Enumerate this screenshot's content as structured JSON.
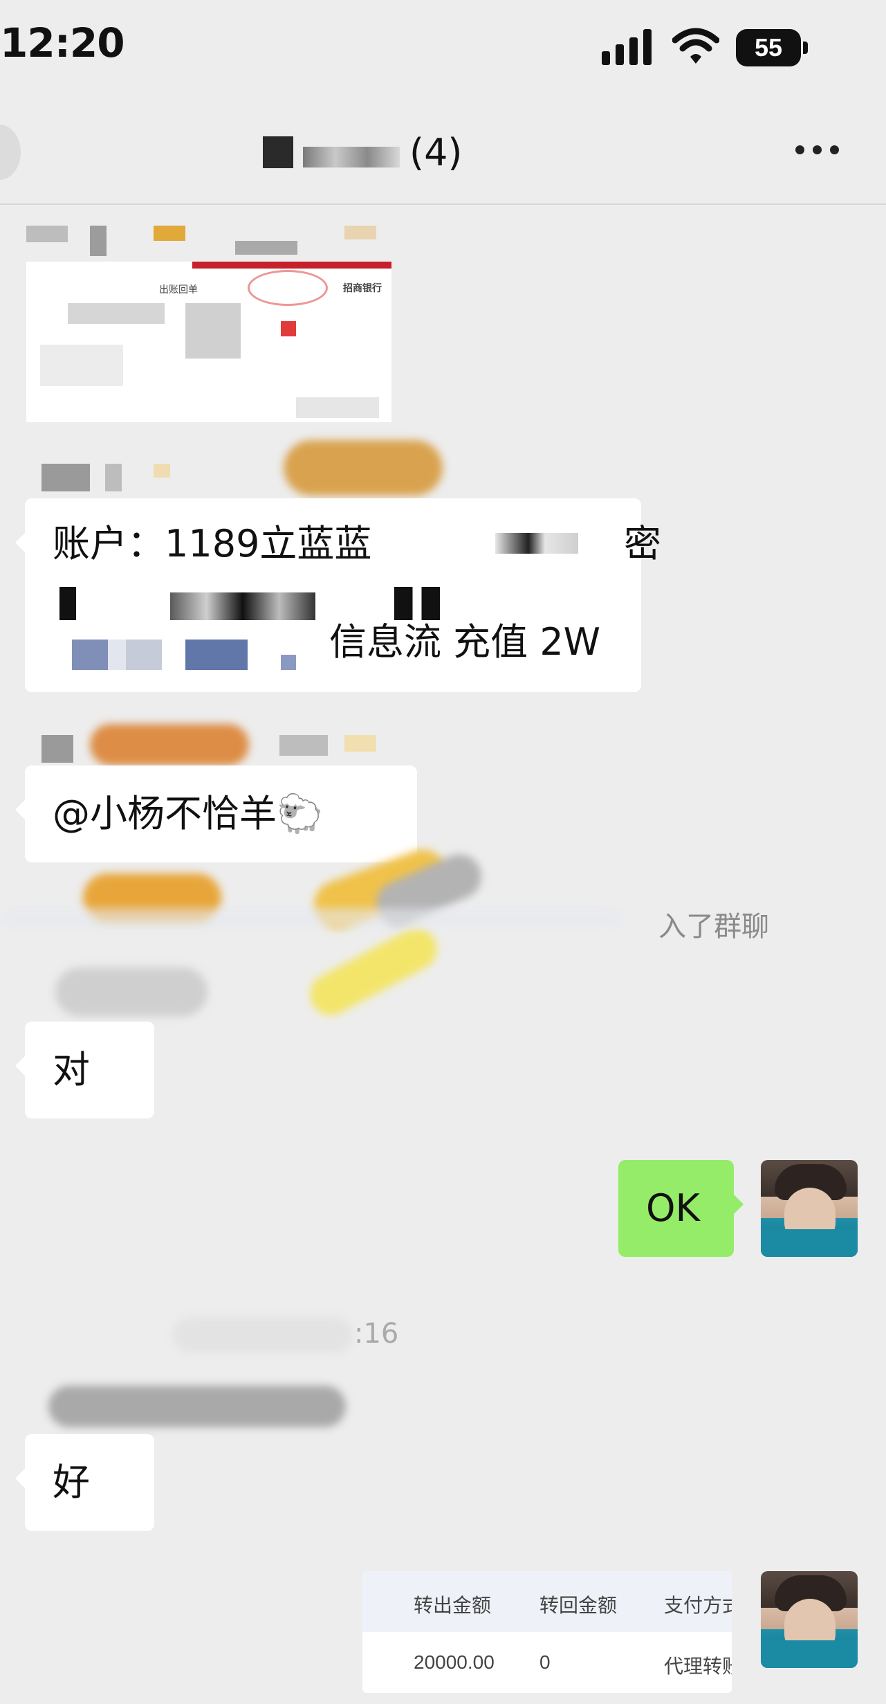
{
  "status_bar": {
    "time": "12:20",
    "battery": "55"
  },
  "nav": {
    "member_count": "(4)"
  },
  "messages": {
    "account_line1_prefix": "账户：1189立蓝蓝",
    "account_line1_suffix": "密",
    "account_line3": "信息流 充值  2W",
    "mention": "@小杨不恰羊🐑",
    "system_notice": "入了群聊",
    "reply_dui": "对",
    "reply_ok": "OK",
    "time_stamp": ":16",
    "reply_hao": "好"
  },
  "receipt": {
    "title": "出账回单",
    "bank": "招商银行"
  },
  "transfer_table": {
    "headers": [
      "转出金额",
      "转回金额",
      "支付方式"
    ],
    "row": [
      "20000.00",
      "0",
      "代理转账"
    ]
  },
  "colors": {
    "chat_bg": "#ededed",
    "outgoing_bubble": "#95ec69",
    "incoming_bubble": "#ffffff"
  }
}
